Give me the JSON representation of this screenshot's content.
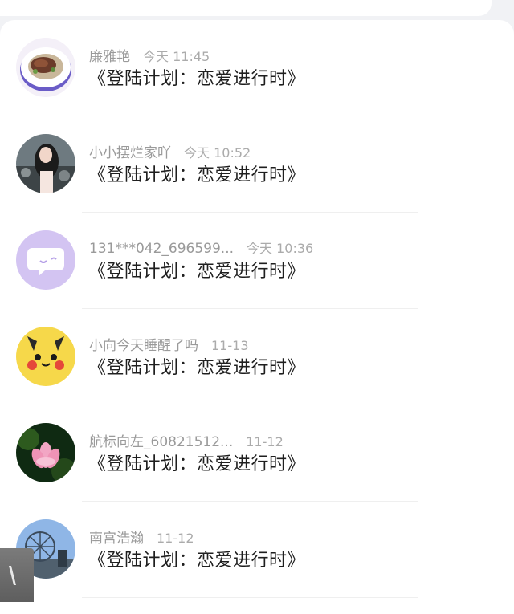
{
  "messages": [
    {
      "name": "廉雅艳",
      "time": "今天 11:45",
      "text": "《登陆计划：恋爱进行时》",
      "avatar_icon": "food-plate-avatar-icon"
    },
    {
      "name": "小小摆烂家吖",
      "time": "今天 10:52",
      "text": "《登陆计划：恋爱进行时》",
      "avatar_icon": "girl-photo-avatar-icon"
    },
    {
      "name": "131***042_696599...",
      "time": "今天 10:36",
      "text": "《登陆计划：恋爱进行时》",
      "avatar_icon": "default-chat-avatar-icon"
    },
    {
      "name": "小向今天睡醒了吗",
      "time": "11-13",
      "text": "《登陆计划：恋爱进行时》",
      "avatar_icon": "pikachu-avatar-icon"
    },
    {
      "name": "航标向左_60821512...",
      "time": "11-12",
      "text": "《登陆计划：恋爱进行时》",
      "avatar_icon": "lotus-flower-avatar-icon"
    },
    {
      "name": "南宫浩瀚",
      "time": "11-12",
      "text": "《登陆计划：恋爱进行时》",
      "avatar_icon": "ferris-wheel-avatar-icon"
    }
  ],
  "colors": {
    "background": "#f1f2f5",
    "card": "#ffffff",
    "name_text": "#9a9a9a",
    "message_text": "#1f1f1f",
    "default_avatar": "#d3c4f2"
  }
}
